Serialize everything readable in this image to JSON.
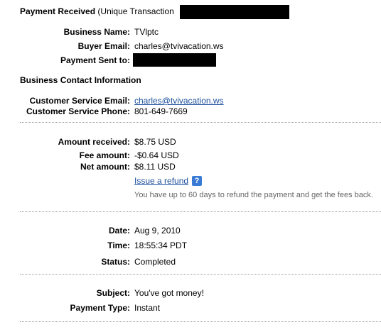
{
  "header": {
    "title": "Payment Received",
    "subtitle": "(Unique Transaction"
  },
  "buyer": {
    "business_name_label": "Business Name:",
    "business_name": "TVlptc",
    "buyer_email_label": "Buyer Email:",
    "buyer_email": "charles@tvivacation.ws",
    "payment_sent_to_label": "Payment Sent to:"
  },
  "contact": {
    "section_title": "Business Contact Information",
    "cs_email_label": "Customer Service Email:",
    "cs_email": "charles@tvivacation.ws",
    "cs_phone_label": "Customer Service Phone:",
    "cs_phone": "801-649-7669"
  },
  "amounts": {
    "received_label": "Amount received:",
    "received": "$8.75 USD",
    "fee_label": "Fee amount:",
    "fee": "-$0.64 USD",
    "net_label": "Net amount:",
    "net": "$8.11 USD",
    "refund_link": "Issue a refund",
    "help_glyph": "?",
    "refund_note": "You have up to 60 days to refund the payment and get the fees back."
  },
  "timing": {
    "date_label": "Date:",
    "date": "Aug 9, 2010",
    "time_label": "Time:",
    "time": "18:55:34 PDT",
    "status_label": "Status:",
    "status": "Completed"
  },
  "details": {
    "subject_label": "Subject:",
    "subject": "You've got money!",
    "payment_type_label": "Payment Type:",
    "payment_type": "Instant"
  },
  "colors": {
    "link": "#1b4f9c",
    "help_icon": "#3a7bd5",
    "note": "#666666",
    "redaction": "#000000"
  }
}
